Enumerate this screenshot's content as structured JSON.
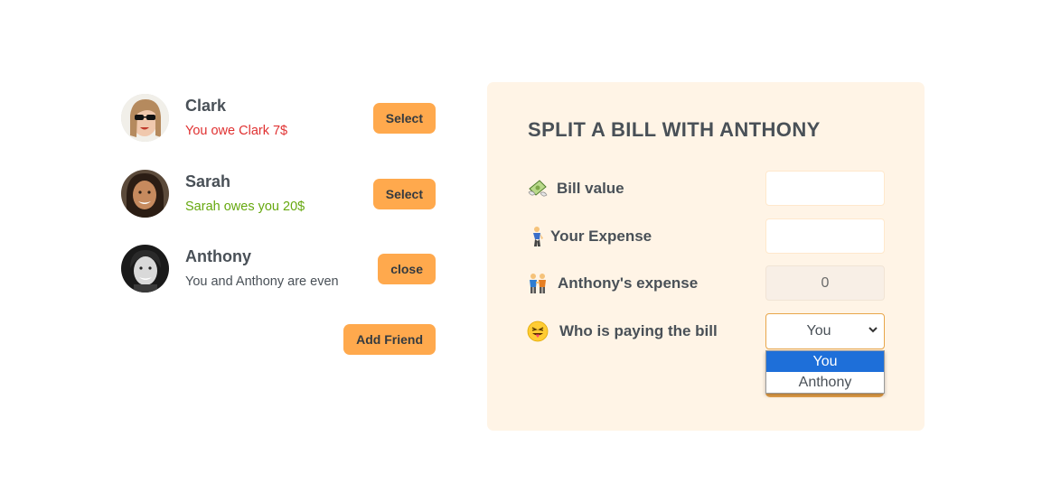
{
  "friends": [
    {
      "name": "Clark",
      "status": "You owe Clark 7$",
      "status_color": "#e03131",
      "button": "Select"
    },
    {
      "name": "Sarah",
      "status": "Sarah owes you 20$",
      "status_color": "#66a80f",
      "button": "Select"
    },
    {
      "name": "Anthony",
      "status": "You and Anthony are even",
      "status_color": "#495057",
      "button": "close"
    }
  ],
  "add_friend_label": "Add Friend",
  "split_form": {
    "title": "SPLIT A BILL WITH ANTHONY",
    "bill_label": "Bill value",
    "bill_value": "",
    "your_expense_label": "Your Expense",
    "your_expense_value": "",
    "friend_expense_label": "Anthony's expense",
    "friend_expense_value": "0",
    "payer_label": "Who is paying the bill",
    "payer_selected": "You",
    "payer_options": [
      "You",
      "Anthony"
    ]
  },
  "colors": {
    "accent": "#ffa94d",
    "panel_bg": "#fff4e6",
    "owe": "#e03131",
    "owed": "#66a80f",
    "option_highlight": "#1e6fd9"
  },
  "icons": {
    "bill": "money-with-wings-icon",
    "your_expense": "person-standing-icon",
    "friend_expense": "two-people-icon",
    "payer": "tongue-face-icon",
    "select_arrow": "chevron-down-icon"
  }
}
